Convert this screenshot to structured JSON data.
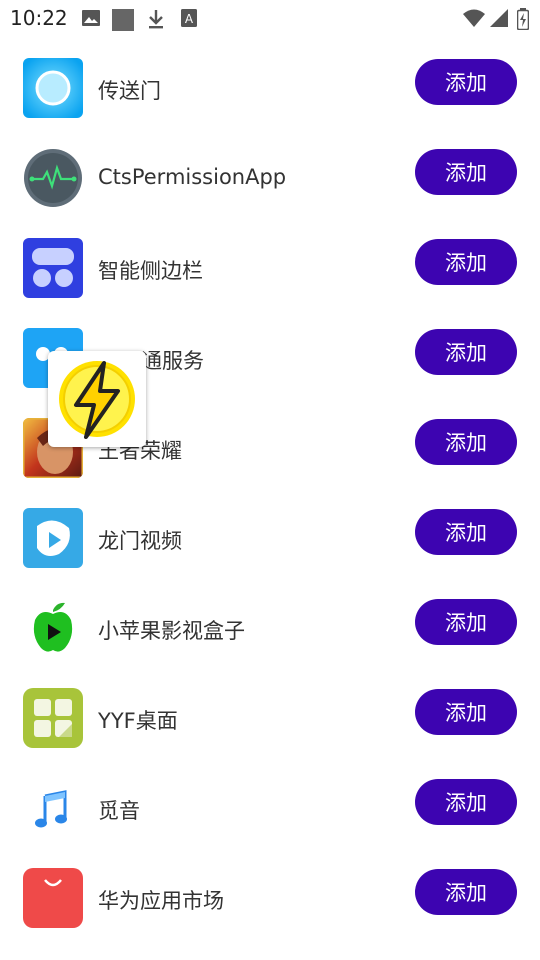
{
  "status_bar": {
    "time": "10:22",
    "left_icons": [
      "image-icon",
      "square-icon",
      "download-icon",
      "text-box-icon"
    ],
    "right_icons": [
      "wifi-icon",
      "signal-icon",
      "battery-icon"
    ]
  },
  "add_label": "添加",
  "accent_color": "#3d04b1",
  "apps": [
    {
      "name": "传送门",
      "icon": "portal-icon"
    },
    {
      "name": "CtsPermissionApp",
      "icon": "heartbeat-icon"
    },
    {
      "name": "智能侧边栏",
      "icon": "sidebar-icon"
    },
    {
      "name": "互通服务",
      "icon": "interconnect-icon"
    },
    {
      "name": "王者荣耀",
      "icon": "game-icon"
    },
    {
      "name": "龙门视频",
      "icon": "video-play-icon"
    },
    {
      "name": "小苹果影视盒子",
      "icon": "apple-play-icon"
    },
    {
      "name": "YYF桌面",
      "icon": "grid-tiles-icon"
    },
    {
      "name": "觅音",
      "icon": "music-note-icon"
    },
    {
      "name": "华为应用市场",
      "icon": "huawei-appgallery-icon"
    }
  ],
  "floating_widget": {
    "icon": "lightning-bolt-icon"
  }
}
